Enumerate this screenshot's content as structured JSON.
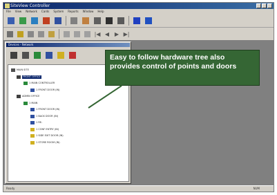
{
  "window": {
    "title": "SiteView Controller",
    "minimize": "_",
    "maximize": "□",
    "close": "x"
  },
  "menubar": [
    "File",
    "View",
    "Network",
    "Cards",
    "System",
    "Reports",
    "Window",
    "Help"
  ],
  "toolbar1": [
    {
      "icon": "person-icon",
      "color": "#3a5fb0"
    },
    {
      "icon": "card-reader-icon",
      "color": "#3a9a4a"
    },
    {
      "icon": "floppy-icon",
      "color": "#2a7fc0"
    },
    {
      "icon": "schedule-icon",
      "color": "#c04020"
    },
    {
      "icon": "group-icon",
      "color": "#3050a0"
    },
    {
      "icon": "report-icon",
      "color": "#808080"
    },
    {
      "icon": "pencil-icon",
      "color": "#c08040"
    },
    {
      "icon": "door-icon",
      "color": "#606060"
    },
    {
      "icon": "alarm-icon",
      "color": "#303030"
    },
    {
      "icon": "camera-icon",
      "color": "#5a5a5a"
    },
    {
      "icon": "grid-icon",
      "color": "#2040c0"
    },
    {
      "icon": "help-icon",
      "color": "#2050c0"
    }
  ],
  "toolbar2": [
    {
      "icon": "new-icon",
      "color": "#707070"
    },
    {
      "icon": "map-icon",
      "color": "#c0a020"
    },
    {
      "icon": "list-icon",
      "color": "#888888"
    },
    {
      "icon": "tree-icon",
      "color": "#909090"
    },
    {
      "icon": "open-folder-icon",
      "color": "#c0a040"
    },
    {
      "icon": "cut-icon",
      "color": "#a0a0a0"
    },
    {
      "icon": "copy-icon",
      "color": "#a0a0a0"
    },
    {
      "icon": "paste-icon",
      "color": "#a0a0a0"
    }
  ],
  "nav_arrows": [
    "|◀",
    "◀",
    "▶",
    "▶|"
  ],
  "panel": {
    "title": "Devices - Network",
    "tools": [
      {
        "icon": "network-icon",
        "color": "#404040"
      },
      {
        "icon": "pc-icon",
        "color": "#505050"
      },
      {
        "icon": "controller-icon",
        "color": "#2a8a3a"
      },
      {
        "icon": "reader-icon",
        "color": "#3050a0"
      },
      {
        "icon": "card-icon",
        "color": "#d0b020"
      },
      {
        "icon": "alarm-panel-icon",
        "color": "#c03030"
      }
    ]
  },
  "tree": [
    {
      "label": "MAIN SITE",
      "level": 0,
      "color": "#505050",
      "selected": false
    },
    {
      "label": "FRONT OFFICE",
      "level": 1,
      "color": "#404040",
      "selected": true
    },
    {
      "label": "1 MAIN CONTROLLER",
      "level": 2,
      "color": "#2a8a3a",
      "selected": false
    },
    {
      "label": "1 FRONT DOOR (IN)",
      "level": 3,
      "color": "#3050a0",
      "selected": false
    },
    {
      "label": "ADMIN OFFICE",
      "level": 1,
      "color": "#404040",
      "selected": false
    },
    {
      "label": "1 MAIN",
      "level": 2,
      "color": "#2a8a3a",
      "selected": false
    },
    {
      "label": "1 FRONT DOOR (IN)",
      "level": 3,
      "color": "#3050a0",
      "selected": false
    },
    {
      "label": "1 BACK DOOR (IN)",
      "level": 3,
      "color": "#3050a0",
      "selected": false
    },
    {
      "label": "1 RE-",
      "level": 3,
      "color": "#3050a0",
      "selected": false
    },
    {
      "label": "1 CONF ENTRY (IN)",
      "level": 3,
      "color": "#d0b020",
      "selected": false
    },
    {
      "label": "1 SIDE EXIT DOOR (IN)",
      "level": 3,
      "color": "#d0b020",
      "selected": false
    },
    {
      "label": "1 STORE ROOM (IN)",
      "level": 3,
      "color": "#d0b020",
      "selected": false
    }
  ],
  "callout": {
    "text": "Easy to follow hardware tree also provides control of points and doors",
    "background": "#356634"
  },
  "status": {
    "left": "Ready",
    "right": "NUM"
  }
}
